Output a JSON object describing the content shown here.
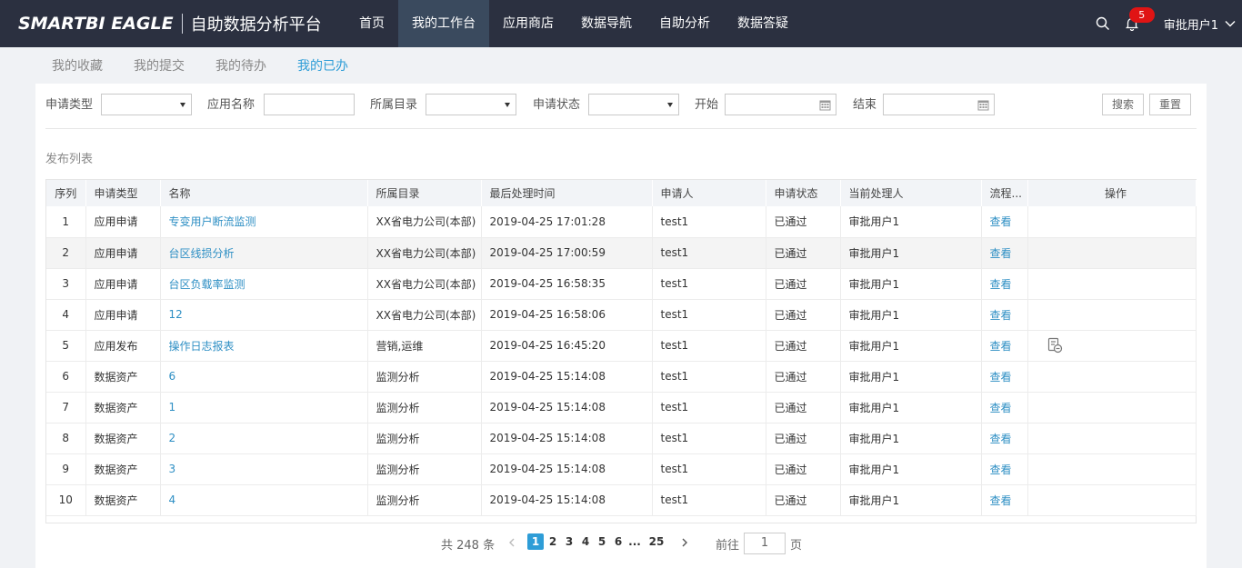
{
  "header": {
    "logo_text": "SMARTBI EAGLE",
    "app_title": "自助数据分析平台",
    "nav": [
      "首页",
      "我的工作台",
      "应用商店",
      "数据导航",
      "自助分析",
      "数据答疑"
    ],
    "active_nav": "我的工作台",
    "notification_count": "5",
    "user_name": "审批用户1"
  },
  "subtabs": {
    "items": [
      "我的收藏",
      "我的提交",
      "我的待办",
      "我的已办"
    ],
    "active": "我的已办"
  },
  "filters": {
    "type_label": "申请类型",
    "app_name_label": "应用名称",
    "catalog_label": "所属目录",
    "status_label": "申请状态",
    "start_label": "开始",
    "end_label": "结束",
    "search_button": "搜索",
    "reset_button": "重置"
  },
  "section_title": "发布列表",
  "table": {
    "columns": [
      "序列",
      "申请类型",
      "名称",
      "所属目录",
      "最后处理时间",
      "申请人",
      "申请状态",
      "当前处理人",
      "流程...",
      "操作"
    ],
    "rows": [
      {
        "seq": "1",
        "type": "应用申请",
        "name": "专变用户断流监测",
        "catalog": "XX省电力公司(本部)",
        "time": "2019-04-25 17:01:28",
        "applicant": "test1",
        "status": "已通过",
        "handler": "审批用户1",
        "flow": "查看",
        "op_icon": false
      },
      {
        "seq": "2",
        "type": "应用申请",
        "name": "台区线损分析",
        "catalog": "XX省电力公司(本部)",
        "time": "2019-04-25 17:00:59",
        "applicant": "test1",
        "status": "已通过",
        "handler": "审批用户1",
        "flow": "查看",
        "op_icon": false
      },
      {
        "seq": "3",
        "type": "应用申请",
        "name": "台区负载率监测",
        "catalog": "XX省电力公司(本部)",
        "time": "2019-04-25 16:58:35",
        "applicant": "test1",
        "status": "已通过",
        "handler": "审批用户1",
        "flow": "查看",
        "op_icon": false
      },
      {
        "seq": "4",
        "type": "应用申请",
        "name": "12",
        "catalog": "XX省电力公司(本部)",
        "time": "2019-04-25 16:58:06",
        "applicant": "test1",
        "status": "已通过",
        "handler": "审批用户1",
        "flow": "查看",
        "op_icon": false
      },
      {
        "seq": "5",
        "type": "应用发布",
        "name": "操作日志报表",
        "catalog": "营销,运维",
        "time": "2019-04-25 16:45:20",
        "applicant": "test1",
        "status": "已通过",
        "handler": "审批用户1",
        "flow": "查看",
        "op_icon": true
      },
      {
        "seq": "6",
        "type": "数据资产",
        "name": "6",
        "catalog": "监测分析",
        "time": "2019-04-25 15:14:08",
        "applicant": "test1",
        "status": "已通过",
        "handler": "审批用户1",
        "flow": "查看",
        "op_icon": false
      },
      {
        "seq": "7",
        "type": "数据资产",
        "name": "1",
        "catalog": "监测分析",
        "time": "2019-04-25 15:14:08",
        "applicant": "test1",
        "status": "已通过",
        "handler": "审批用户1",
        "flow": "查看",
        "op_icon": false
      },
      {
        "seq": "8",
        "type": "数据资产",
        "name": "2",
        "catalog": "监测分析",
        "time": "2019-04-25 15:14:08",
        "applicant": "test1",
        "status": "已通过",
        "handler": "审批用户1",
        "flow": "查看",
        "op_icon": false
      },
      {
        "seq": "9",
        "type": "数据资产",
        "name": "3",
        "catalog": "监测分析",
        "time": "2019-04-25 15:14:08",
        "applicant": "test1",
        "status": "已通过",
        "handler": "审批用户1",
        "flow": "查看",
        "op_icon": false
      },
      {
        "seq": "10",
        "type": "数据资产",
        "name": "4",
        "catalog": "监测分析",
        "time": "2019-04-25 15:14:08",
        "applicant": "test1",
        "status": "已通过",
        "handler": "审批用户1",
        "flow": "查看",
        "op_icon": false
      }
    ]
  },
  "pagination": {
    "total_text": "共 248 条",
    "pages": [
      "1",
      "2",
      "3",
      "4",
      "5",
      "6",
      "...",
      "25"
    ],
    "current": "1",
    "goto_label": "前往",
    "goto_value": "1",
    "page_suffix": "页"
  },
  "colors": {
    "topbar": "#2b3040",
    "accent": "#2e9dd7",
    "link": "#2e8fc4",
    "badge": "#e01414"
  }
}
